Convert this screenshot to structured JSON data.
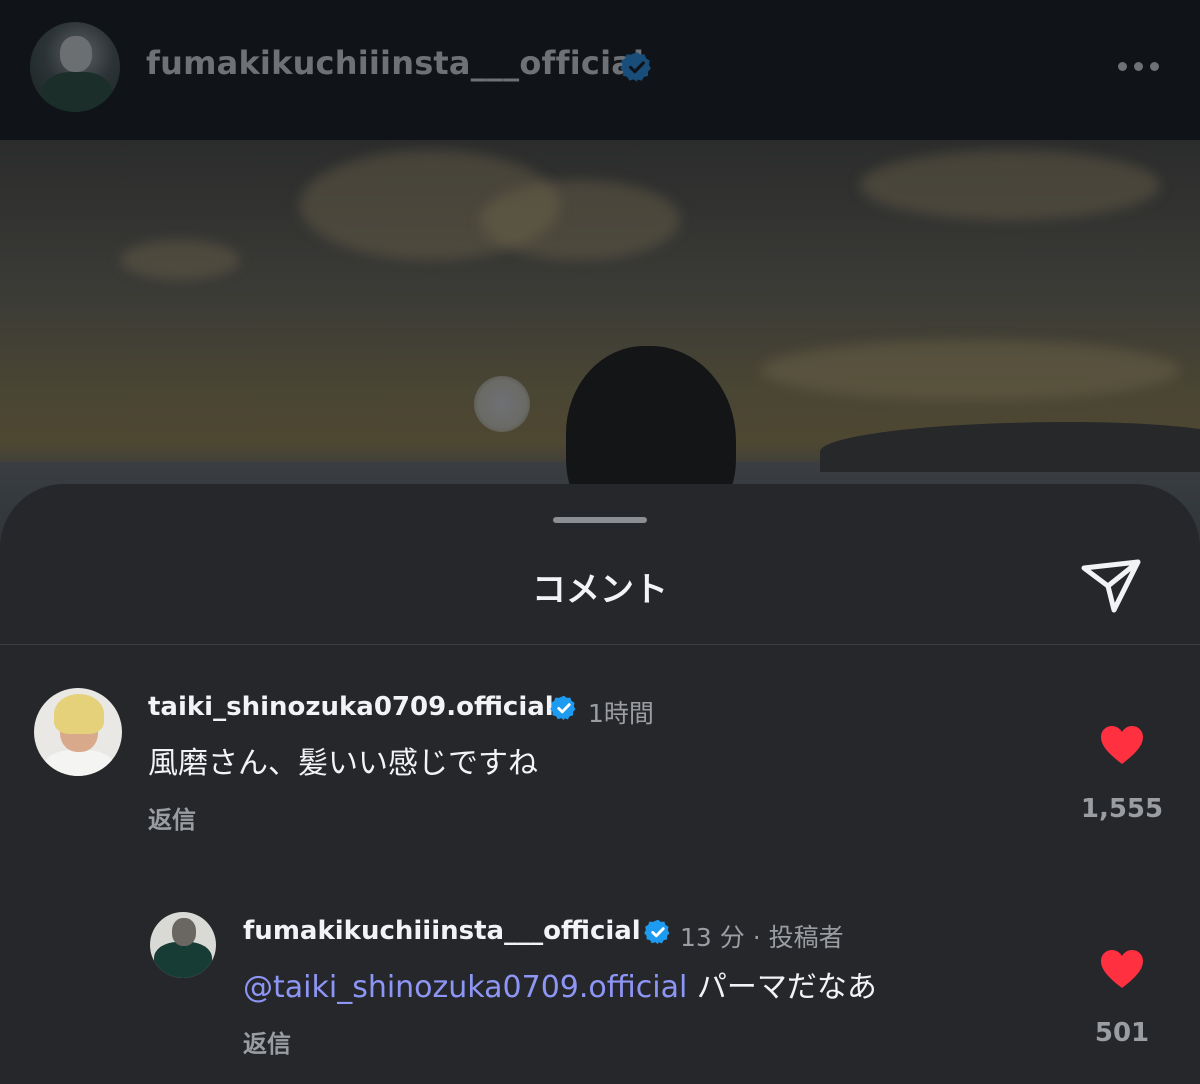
{
  "post": {
    "username": "fumakikuchiiinsta___official",
    "verified": true
  },
  "sheet": {
    "title": "コメント"
  },
  "comments": [
    {
      "username": "taiki_shinozuka0709.official",
      "verified": true,
      "time": "1時間",
      "text": "風磨さん、髪いい感じですね",
      "reply_label": "返信",
      "likes": "1,555",
      "liked": true
    }
  ],
  "replies": [
    {
      "username": "fumakikuchiiinsta___official",
      "verified": true,
      "time": "13 分 · 投稿者",
      "mention": "@taiki_shinozuka0709.official",
      "text": " パーマだなあ",
      "reply_label": "返信",
      "likes": "501",
      "liked": true
    }
  ],
  "colors": {
    "background": "#25272b",
    "like_red": "#ff3040",
    "verified_blue": "#1d9bf0",
    "mention_link": "#8e96f5"
  },
  "icons": [
    "more-options-icon",
    "verified-badge-icon",
    "share-send-icon",
    "heart-icon",
    "drag-handle"
  ]
}
